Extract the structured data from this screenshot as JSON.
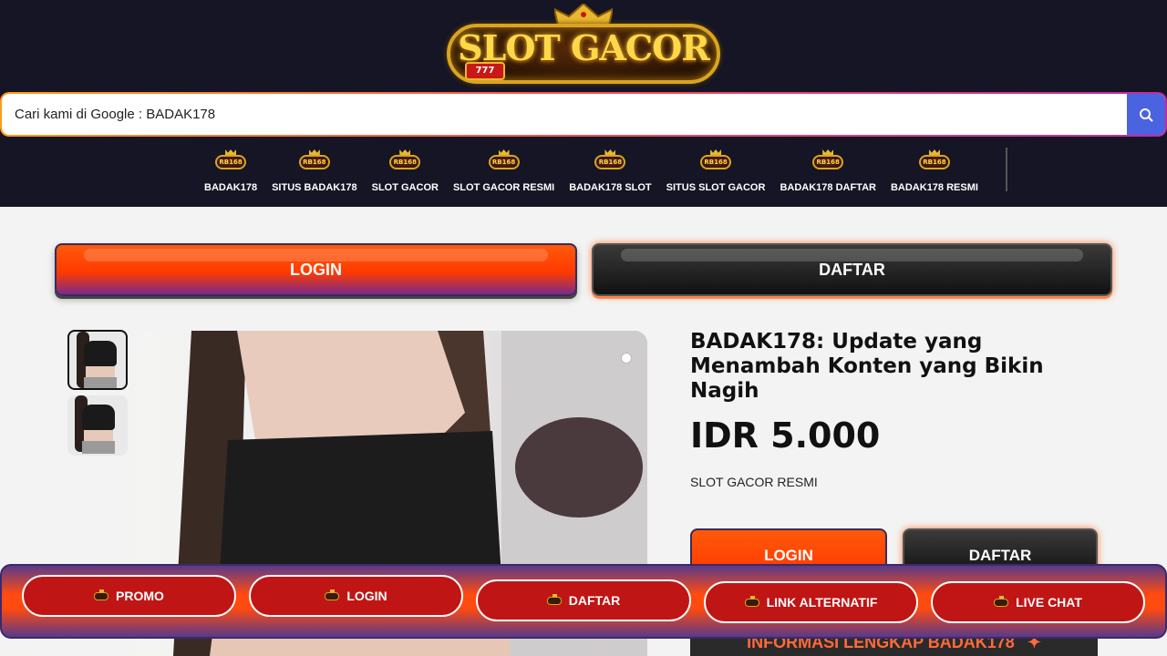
{
  "header": {
    "logo_text": "SLOT GACOR",
    "logo_reels": "777",
    "nav_badge_text": "RB168"
  },
  "search": {
    "placeholder": "Cari kami di Google : BADAK178",
    "icon": "search-icon"
  },
  "nav": {
    "items": [
      {
        "label": "BADAK178"
      },
      {
        "label": "SITUS BADAK178"
      },
      {
        "label": "SLOT GACOR"
      },
      {
        "label": "SLOT GACOR RESMI"
      },
      {
        "label": "BADAK178 SLOT"
      },
      {
        "label": "SITUS SLOT GACOR"
      },
      {
        "label": "BADAK178 DAFTAR"
      },
      {
        "label": "BADAK178 RESMI"
      }
    ]
  },
  "actions": {
    "login_label": "LOGIN",
    "daftar_label": "DAFTAR"
  },
  "product": {
    "title": "BADAK178: Update yang Menambah Konten yang Bikin Nagih",
    "price": "IDR 5.000",
    "subtitle": "SLOT GACOR RESMI",
    "login_label": "LOGIN",
    "daftar_label": "DAFTAR",
    "info_label": "INFORMASI LENGKAP BADAK178",
    "info_icon": "sparkle-icon"
  },
  "bottom_bar": {
    "items": [
      {
        "label": "PROMO"
      },
      {
        "label": "LOGIN"
      },
      {
        "label": "DAFTAR"
      },
      {
        "label": "LINK ALTERNATIF"
      },
      {
        "label": "LIVE CHAT"
      }
    ]
  },
  "colors": {
    "header_bg": "#151526",
    "accent_orange": "#ff4a10",
    "search_button": "#4a63e0",
    "pill_red": "#c01515"
  }
}
